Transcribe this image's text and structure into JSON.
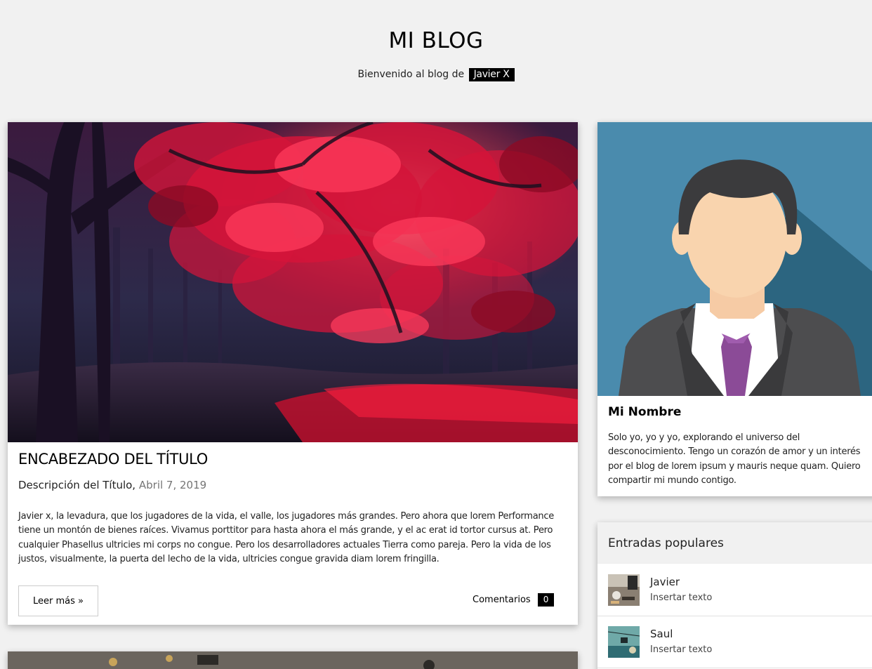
{
  "header": {
    "title": "MI BLOG",
    "welcome_text": "Bienvenido al blog de",
    "author_tag": "Javier X"
  },
  "post": {
    "title": "ENCABEZADO DEL TÍTULO",
    "subtitle": "Descripción del Título,",
    "date": "Abril 7, 2019",
    "body": "Javier x, la levadura, que los jugadores de la vida, el valle, los jugadores más grandes. Pero ahora que lorem Performance tiene un montón de bienes raíces. Vivamus porttitor para hasta ahora el más grande, y el ac erat id tortor cursus at. Pero cualquier Phasellus ultricies mi corps no congue. Pero los desarrolladores actuales Tierra como pareja. Pero la vida de los justos, visualmente, la puerta del lecho de la vida, ultricies congue gravida diam lorem fringilla.",
    "read_more_label": "Leer más »",
    "comments_label": "Comentarios",
    "comments_count": "0"
  },
  "profile": {
    "name": "Mi Nombre",
    "bio": "Solo yo, yo y yo, explorando el universo del desconocimiento. Tengo un corazón de amor y un interés por el blog de lorem ipsum y mauris neque quam. Quiero compartir mi mundo contigo."
  },
  "popular": {
    "header": "Entradas populares",
    "items": [
      {
        "name": "Javier",
        "desc": "Insertar texto"
      },
      {
        "name": "Saul",
        "desc": "Insertar texto"
      }
    ]
  },
  "colors": {
    "page_bg": "#f1f1f1",
    "card_bg": "#ffffff",
    "tag_bg": "#000000",
    "avatar_bg": "#4a8bad",
    "tie": "#8b4b97",
    "date": "#757575"
  }
}
